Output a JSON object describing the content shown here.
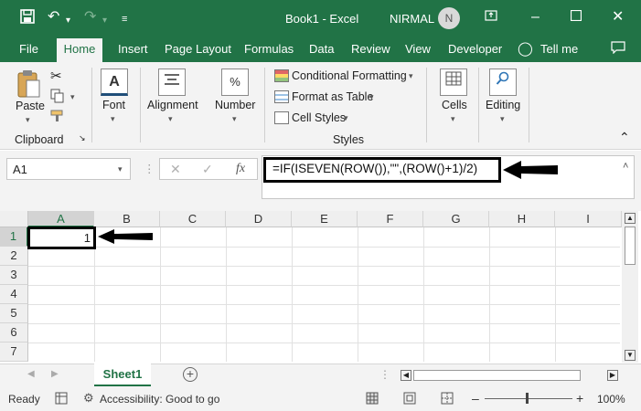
{
  "titlebar": {
    "title": "Book1  -  Excel",
    "user": "NIRMAL",
    "avatar_initial": "N"
  },
  "menu": {
    "file": "File",
    "home": "Home",
    "insert": "Insert",
    "page_layout": "Page Layout",
    "formulas": "Formulas",
    "data": "Data",
    "review": "Review",
    "view": "View",
    "developer": "Developer",
    "tell_me": "Tell me"
  },
  "ribbon": {
    "paste": "Paste",
    "clipboard": "Clipboard",
    "font": "Font",
    "alignment": "Alignment",
    "number": "Number",
    "number_icon": "%",
    "conditional_formatting": "Conditional Formatting",
    "format_as_table": "Format as Table",
    "cell_styles": "Cell Styles",
    "styles": "Styles",
    "cells": "Cells",
    "editing": "Editing"
  },
  "formula_bar": {
    "name_box": "A1",
    "formula": "=IF(ISEVEN(ROW()),\"\",(ROW()+1)/2)",
    "fx": "fx"
  },
  "grid": {
    "columns": [
      "A",
      "B",
      "C",
      "D",
      "E",
      "F",
      "G",
      "H",
      "I"
    ],
    "rows": [
      "1",
      "2",
      "3",
      "4",
      "5",
      "6",
      "7"
    ],
    "active_cell_value": "1"
  },
  "sheets": {
    "active": "Sheet1"
  },
  "status": {
    "ready": "Ready",
    "accessibility": "Accessibility: Good to go",
    "zoom": "100%"
  },
  "colors": {
    "accent": "#217346",
    "ribbon_bg": "#f3f3f3"
  }
}
